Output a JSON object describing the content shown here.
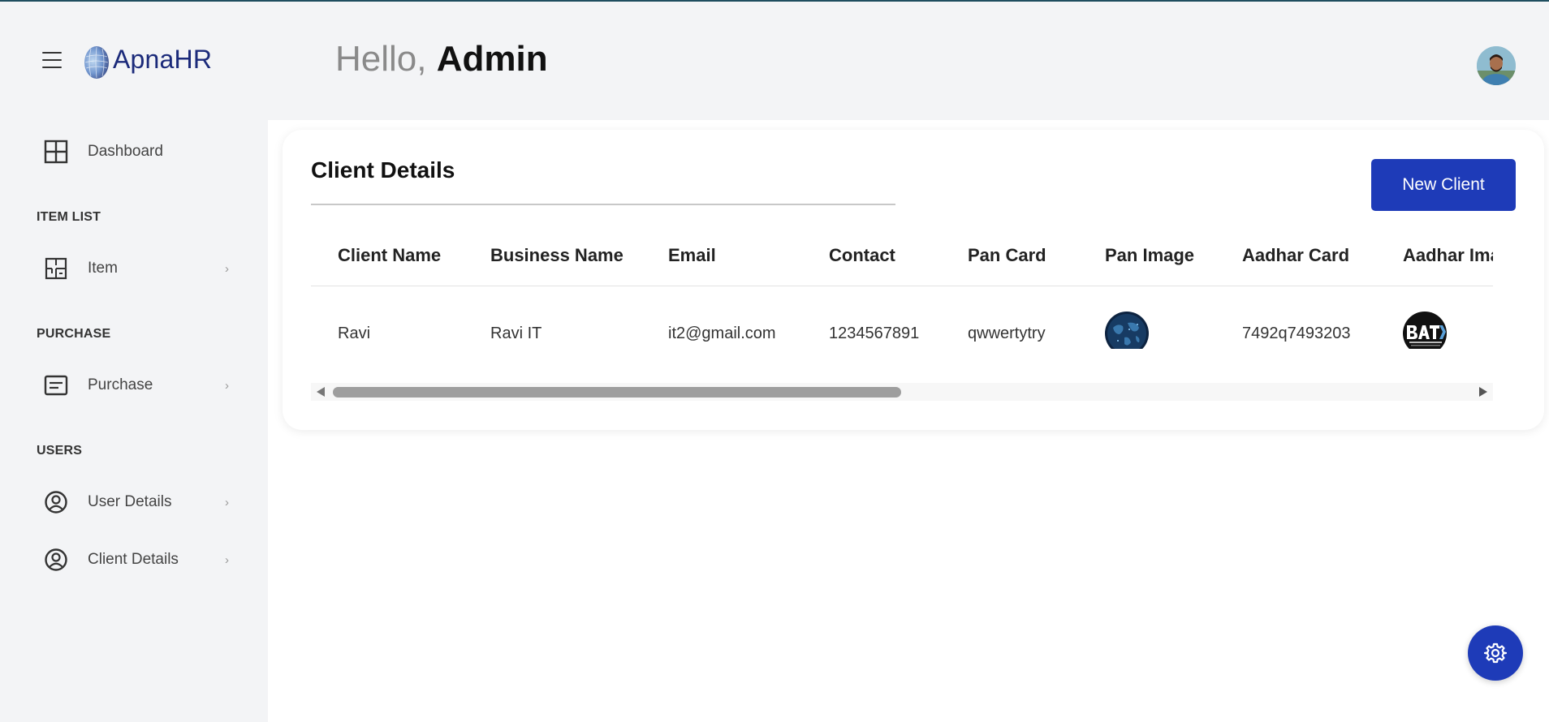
{
  "header": {
    "logo_text": "ApnaHR",
    "greeting_prefix": "Hello,",
    "greeting_name": "Admin"
  },
  "sidebar": {
    "dashboard": {
      "label": "Dashboard",
      "icon": "grid-icon"
    },
    "sections": [
      {
        "title": "ITEM LIST",
        "items": [
          {
            "label": "Item",
            "icon": "floorplan-icon"
          }
        ]
      },
      {
        "title": "PURCHASE",
        "items": [
          {
            "label": "Purchase",
            "icon": "list-box-icon"
          }
        ]
      },
      {
        "title": "USERS",
        "items": [
          {
            "label": "User Details",
            "icon": "user-circle-icon"
          },
          {
            "label": "Client Details",
            "icon": "user-circle-icon"
          }
        ]
      }
    ]
  },
  "card": {
    "title": "Client Details",
    "new_button": "New Client"
  },
  "table": {
    "columns": [
      "Client Name",
      "Business Name",
      "Email",
      "Contact",
      "Pan Card",
      "Pan Image",
      "Aadhar Card",
      "Aadhar Image"
    ],
    "rows": [
      {
        "client_name": "Ravi",
        "business_name": "Ravi IT",
        "email": "it2@gmail.com",
        "contact": "1234567891",
        "pan_card": "qwwertytry",
        "pan_image": "globe-image",
        "aadhar_card": "7492q7493203",
        "aadhar_image": "batx-logo-image"
      }
    ]
  },
  "colors": {
    "primary": "#1e3bb8",
    "logo": "#1b2a7a",
    "sidebar_bg": "#f3f4f6"
  },
  "fab": {
    "icon": "gear-icon"
  }
}
